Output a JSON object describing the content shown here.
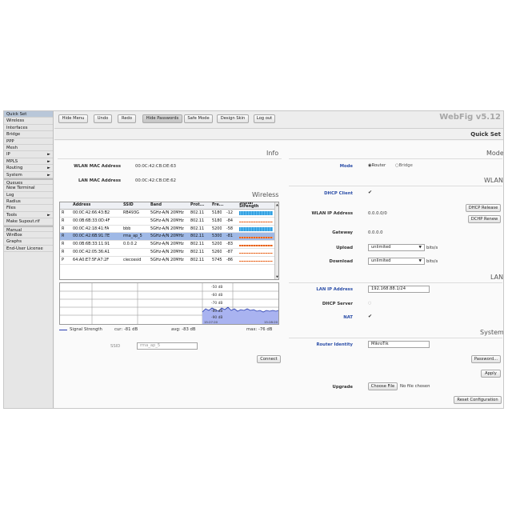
{
  "sidebar": {
    "items": [
      {
        "label": "Quick Set",
        "arrow": false
      },
      {
        "label": "Wireless",
        "arrow": false
      },
      {
        "label": "Interfaces",
        "arrow": false
      },
      {
        "label": "Bridge",
        "arrow": false
      },
      {
        "label": "PPP",
        "arrow": false
      },
      {
        "label": "Mesh",
        "arrow": false
      },
      {
        "label": "IP",
        "arrow": true
      },
      {
        "label": "MPLS",
        "arrow": true
      },
      {
        "label": "Routing",
        "arrow": true
      },
      {
        "label": "System",
        "arrow": true
      },
      {
        "label": "Queues",
        "arrow": false
      },
      {
        "label": "New Terminal",
        "arrow": false
      },
      {
        "label": "Log",
        "arrow": false
      },
      {
        "label": "Radius",
        "arrow": false
      },
      {
        "label": "Files",
        "arrow": false
      },
      {
        "label": "Tools",
        "arrow": true
      },
      {
        "label": "Make Supout.rif",
        "arrow": false
      },
      {
        "label": "Manual",
        "arrow": false
      },
      {
        "label": "WinBox",
        "arrow": false
      },
      {
        "label": "Graphs",
        "arrow": false
      },
      {
        "label": "End-User License",
        "arrow": false
      }
    ],
    "arrow_glyph": "►"
  },
  "toolbar": {
    "hide_menu": "Hide Menu",
    "undo": "Undo",
    "redo": "Redo",
    "hide_passwords": "Hide Passwords",
    "safe_mode": "Safe Mode",
    "design_skin": "Design Skin",
    "log_out": "Log out",
    "brand": "WebFig v5.12"
  },
  "page_title": "Quick Set",
  "info": {
    "title": "Info",
    "wlan_mac_label": "WLAN MAC Address",
    "wlan_mac_value": "00:0C:42:CB:DE:63",
    "lan_mac_label": "LAN MAC Address",
    "lan_mac_value": "00:0C:42:CB:DE:62"
  },
  "wireless": {
    "title": "Wireless",
    "columns": [
      "Address",
      "SSID",
      "Band",
      "Prot...",
      "Fre...",
      "Signal Strength"
    ],
    "rows": [
      {
        "flag": "R",
        "address": "00:0C:42:66:43:B2",
        "ssid": "RB493G",
        "band": "5GHz-A/N 20MHz",
        "prot": "802.11",
        "freq": "5180",
        "signal": "-12",
        "quality": "good"
      },
      {
        "flag": "R",
        "address": "00:0B:6B:33:0D:4F",
        "ssid": "",
        "band": "5GHz-A/N 20MHz",
        "prot": "802.11",
        "freq": "5180",
        "signal": "-84",
        "quality": "bad"
      },
      {
        "flag": "R",
        "address": "00:0C:42:18:41:FA",
        "ssid": "bbb",
        "band": "5GHz-A/N 20MHz",
        "prot": "802.11",
        "freq": "5200",
        "signal": "-58",
        "quality": "good"
      },
      {
        "flag": "R",
        "address": "00:0C:42:6B:91:7E",
        "ssid": "rma_ap_5",
        "band": "5GHz-A/N 20MHz",
        "prot": "802.11",
        "freq": "5300",
        "signal": "-81",
        "quality": "bad"
      },
      {
        "flag": "R",
        "address": "00:0B:6B:33:11:91",
        "ssid": "0.0.0.2",
        "band": "5GHz-A/N 20MHz",
        "prot": "802.11",
        "freq": "5200",
        "signal": "-83",
        "quality": "bad"
      },
      {
        "flag": "R",
        "address": "00:0C:42:05:36:A1",
        "ssid": "",
        "band": "5GHz-A/N 20MHz",
        "prot": "802.11",
        "freq": "5260",
        "signal": "-87",
        "quality": "bad"
      },
      {
        "flag": "P",
        "address": "64:A0:E7:5F:A7:2F",
        "ssid": "ciecossid",
        "band": "5GHz-A/N 20MHz",
        "prot": "802.11",
        "freq": "5745",
        "signal": "-86",
        "quality": "bad"
      }
    ],
    "selected_row": 3
  },
  "graph": {
    "scale_labels": [
      "-50 dB",
      "-60 dB",
      "-70 dB",
      "-80 dB",
      "-90 dB"
    ],
    "time_start": "15:27:20",
    "time_end": "15:28:20",
    "legend_label": "Signal Strength",
    "cur": "cur: -81 dB",
    "avg": "avg: -83 dB",
    "max": "max: -76 dB",
    "line_color": "#2a3fb0",
    "fill_color": "#a9b3f0"
  },
  "ssid_field": {
    "label": "SSID",
    "value": "rma_ap_5"
  },
  "connect_button": "Connect",
  "mode": {
    "title": "Mode",
    "label": "Mode",
    "options": [
      "Router",
      "Bridge"
    ],
    "selected": "Router"
  },
  "wlan": {
    "title": "WLAN",
    "dhcp_client_label": "DHCP Client",
    "dhcp_client_checked": true,
    "dhcp_release": "DHCP Release",
    "dhcp_renew": "DCHP Renew",
    "ip_label": "WLAN IP Address",
    "ip_value": "0.0.0.0/0",
    "gateway_label": "Gateway",
    "gateway_value": "0.0.0.0",
    "upload_label": "Upload",
    "upload_value": "unlimited",
    "download_label": "Download",
    "download_value": "unlimited",
    "unit": "bits/s"
  },
  "lan": {
    "title": "LAN",
    "ip_label": "LAN IP Address",
    "ip_value": "192.168.88.1/24",
    "dhcp_server_label": "DHCP Server",
    "dhcp_server_checked": false,
    "nat_label": "NAT",
    "nat_checked": true
  },
  "system": {
    "title": "System",
    "identity_label": "Router Identity",
    "identity_value": "MikroTik",
    "password_button": "Password...",
    "apply_button": "Apply",
    "upgrade_label": "Upgrade",
    "choose_file": "Choose File",
    "no_file": "No file chosen",
    "reset_button": "Reset Configuration"
  },
  "glyphs": {
    "check": "✔",
    "radio_on": "◉",
    "radio_off": "○",
    "dropdown": "▼",
    "scroll_up": "▲",
    "scroll_down": "▼"
  }
}
